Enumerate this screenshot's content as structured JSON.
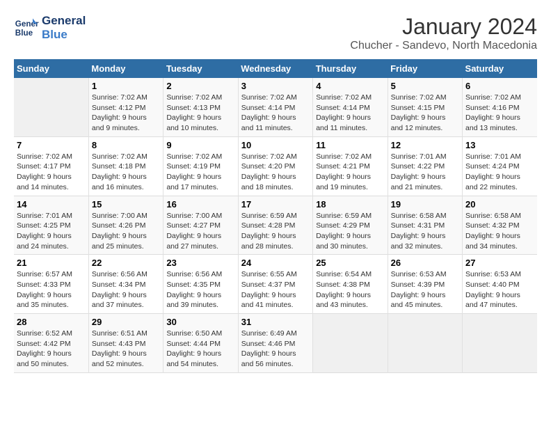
{
  "header": {
    "logo": {
      "line1": "General",
      "line2": "Blue"
    },
    "title": "January 2024",
    "subtitle": "Chucher - Sandevo, North Macedonia"
  },
  "calendar": {
    "weekdays": [
      "Sunday",
      "Monday",
      "Tuesday",
      "Wednesday",
      "Thursday",
      "Friday",
      "Saturday"
    ],
    "weeks": [
      [
        {
          "day": "",
          "empty": true
        },
        {
          "day": "1",
          "sunrise": "7:02 AM",
          "sunset": "4:12 PM",
          "daylight": "9 hours and 9 minutes."
        },
        {
          "day": "2",
          "sunrise": "7:02 AM",
          "sunset": "4:13 PM",
          "daylight": "9 hours and 10 minutes."
        },
        {
          "day": "3",
          "sunrise": "7:02 AM",
          "sunset": "4:14 PM",
          "daylight": "9 hours and 11 minutes."
        },
        {
          "day": "4",
          "sunrise": "7:02 AM",
          "sunset": "4:14 PM",
          "daylight": "9 hours and 11 minutes."
        },
        {
          "day": "5",
          "sunrise": "7:02 AM",
          "sunset": "4:15 PM",
          "daylight": "9 hours and 12 minutes."
        },
        {
          "day": "6",
          "sunrise": "7:02 AM",
          "sunset": "4:16 PM",
          "daylight": "9 hours and 13 minutes."
        }
      ],
      [
        {
          "day": "7",
          "sunrise": "7:02 AM",
          "sunset": "4:17 PM",
          "daylight": "9 hours and 14 minutes."
        },
        {
          "day": "8",
          "sunrise": "7:02 AM",
          "sunset": "4:18 PM",
          "daylight": "9 hours and 16 minutes."
        },
        {
          "day": "9",
          "sunrise": "7:02 AM",
          "sunset": "4:19 PM",
          "daylight": "9 hours and 17 minutes."
        },
        {
          "day": "10",
          "sunrise": "7:02 AM",
          "sunset": "4:20 PM",
          "daylight": "9 hours and 18 minutes."
        },
        {
          "day": "11",
          "sunrise": "7:02 AM",
          "sunset": "4:21 PM",
          "daylight": "9 hours and 19 minutes."
        },
        {
          "day": "12",
          "sunrise": "7:01 AM",
          "sunset": "4:22 PM",
          "daylight": "9 hours and 21 minutes."
        },
        {
          "day": "13",
          "sunrise": "7:01 AM",
          "sunset": "4:24 PM",
          "daylight": "9 hours and 22 minutes."
        }
      ],
      [
        {
          "day": "14",
          "sunrise": "7:01 AM",
          "sunset": "4:25 PM",
          "daylight": "9 hours and 24 minutes."
        },
        {
          "day": "15",
          "sunrise": "7:00 AM",
          "sunset": "4:26 PM",
          "daylight": "9 hours and 25 minutes."
        },
        {
          "day": "16",
          "sunrise": "7:00 AM",
          "sunset": "4:27 PM",
          "daylight": "9 hours and 27 minutes."
        },
        {
          "day": "17",
          "sunrise": "6:59 AM",
          "sunset": "4:28 PM",
          "daylight": "9 hours and 28 minutes."
        },
        {
          "day": "18",
          "sunrise": "6:59 AM",
          "sunset": "4:29 PM",
          "daylight": "9 hours and 30 minutes."
        },
        {
          "day": "19",
          "sunrise": "6:58 AM",
          "sunset": "4:31 PM",
          "daylight": "9 hours and 32 minutes."
        },
        {
          "day": "20",
          "sunrise": "6:58 AM",
          "sunset": "4:32 PM",
          "daylight": "9 hours and 34 minutes."
        }
      ],
      [
        {
          "day": "21",
          "sunrise": "6:57 AM",
          "sunset": "4:33 PM",
          "daylight": "9 hours and 35 minutes."
        },
        {
          "day": "22",
          "sunrise": "6:56 AM",
          "sunset": "4:34 PM",
          "daylight": "9 hours and 37 minutes."
        },
        {
          "day": "23",
          "sunrise": "6:56 AM",
          "sunset": "4:35 PM",
          "daylight": "9 hours and 39 minutes."
        },
        {
          "day": "24",
          "sunrise": "6:55 AM",
          "sunset": "4:37 PM",
          "daylight": "9 hours and 41 minutes."
        },
        {
          "day": "25",
          "sunrise": "6:54 AM",
          "sunset": "4:38 PM",
          "daylight": "9 hours and 43 minutes."
        },
        {
          "day": "26",
          "sunrise": "6:53 AM",
          "sunset": "4:39 PM",
          "daylight": "9 hours and 45 minutes."
        },
        {
          "day": "27",
          "sunrise": "6:53 AM",
          "sunset": "4:40 PM",
          "daylight": "9 hours and 47 minutes."
        }
      ],
      [
        {
          "day": "28",
          "sunrise": "6:52 AM",
          "sunset": "4:42 PM",
          "daylight": "9 hours and 50 minutes."
        },
        {
          "day": "29",
          "sunrise": "6:51 AM",
          "sunset": "4:43 PM",
          "daylight": "9 hours and 52 minutes."
        },
        {
          "day": "30",
          "sunrise": "6:50 AM",
          "sunset": "4:44 PM",
          "daylight": "9 hours and 54 minutes."
        },
        {
          "day": "31",
          "sunrise": "6:49 AM",
          "sunset": "4:46 PM",
          "daylight": "9 hours and 56 minutes."
        },
        {
          "day": "",
          "empty": true
        },
        {
          "day": "",
          "empty": true
        },
        {
          "day": "",
          "empty": true
        }
      ]
    ]
  }
}
